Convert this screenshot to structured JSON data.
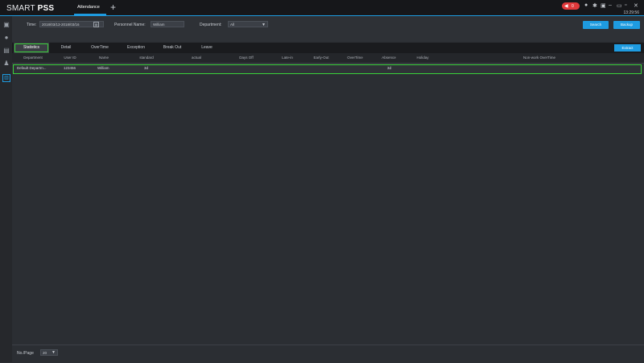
{
  "app": {
    "logo_light": "SMART ",
    "logo_bold": "PSS",
    "active_tab": "Attendance",
    "add_tab_icon": "+",
    "alert_count": "0",
    "clock": "13:29:56",
    "accent_color": "#1e9be0",
    "highlight_color": "#3ad13a"
  },
  "filters": {
    "time_label": "Time:",
    "time_value": "2018/03/13-2018/03/16",
    "personnel_label": "Personnel Name:",
    "personnel_value": "William",
    "department_label": "Department:",
    "department_value": "All"
  },
  "buttons": {
    "search": "Search",
    "backup": "Backup",
    "extract": "Extract"
  },
  "tabs": [
    {
      "label": "Statistics",
      "active": true
    },
    {
      "label": "Detail"
    },
    {
      "label": "OverTime"
    },
    {
      "label": "Exception"
    },
    {
      "label": "Break Out"
    },
    {
      "label": "Leave"
    }
  ],
  "table": {
    "columns": [
      "Department",
      "User ID",
      "Name",
      "standard",
      "actual",
      "Days Off",
      "Late-in",
      "Early-Out",
      "OverTime",
      "Absence",
      "Holiday",
      "Non-work OverTime"
    ],
    "rows": [
      [
        "Default Departm...",
        "123456",
        "William",
        "3d",
        "",
        "",
        "",
        "",
        "",
        "3d",
        "",
        ""
      ]
    ]
  },
  "footer": {
    "per_page_label": "No./Page",
    "per_page_value": "20"
  }
}
